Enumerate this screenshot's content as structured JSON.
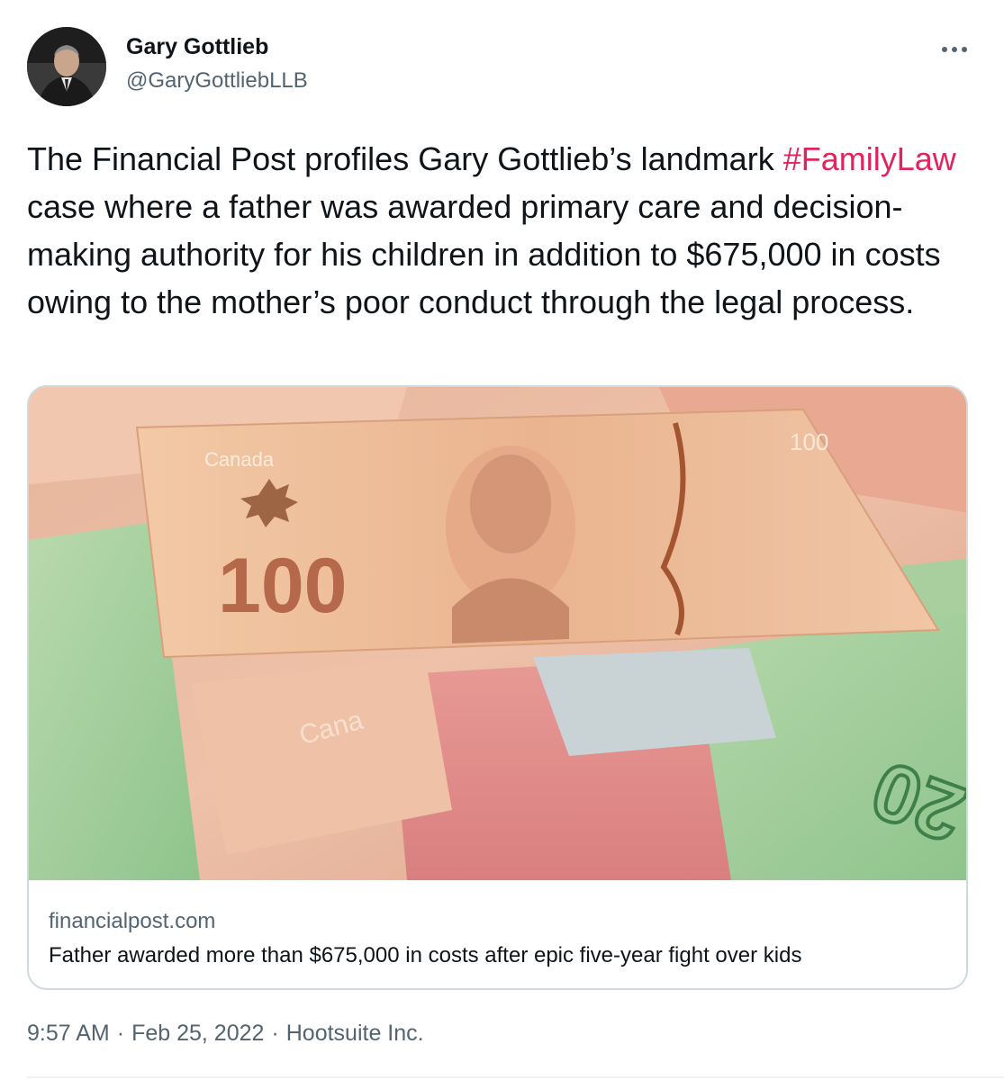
{
  "author": {
    "name": "Gary Gottlieb",
    "handle": "@GaryGottliebLLB"
  },
  "menu": {
    "icon": "more-horizontal-icon"
  },
  "tweet": {
    "text_before": "The Financial Post profiles Gary Gottlieb’s landmark ",
    "hashtag": "#FamilyLaw",
    "text_after": " case where a father was awarded primary care and decision-making authority for his children in addition to $675,000 in costs owing to the mother’s poor conduct through the legal process."
  },
  "card": {
    "domain": "financialpost.com",
    "title": "Father awarded more than $675,000 in costs after epic five-year fight over kids",
    "image": {
      "note_text_canada": "Canada",
      "note_text_100": "100",
      "note_text_20": "20"
    }
  },
  "meta": {
    "time": "9:57 AM",
    "separator": "·",
    "date": "Feb 25, 2022",
    "source": "Hootsuite Inc."
  },
  "colors": {
    "hashtag": "#e0245e",
    "secondary_text": "#536471",
    "primary_text": "#0f1419",
    "card_border": "#cfd9de"
  }
}
